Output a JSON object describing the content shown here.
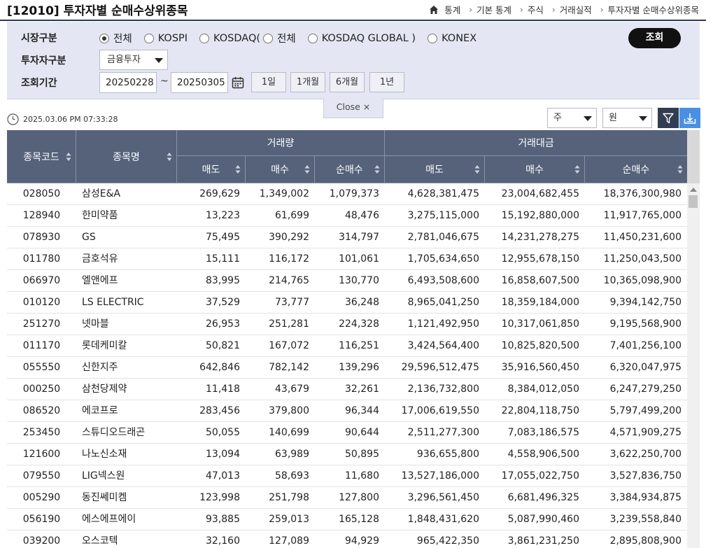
{
  "header": {
    "title": "[12010] 투자자별 순매수상위종목",
    "breadcrumb": [
      "통계",
      "기본 통계",
      "주식",
      "거래실적",
      "투자자별 순매수상위종목"
    ]
  },
  "search": {
    "market_label": "시장구분",
    "market_options": [
      {
        "label": "전체",
        "checked": true
      },
      {
        "label": "KOSPI",
        "checked": false
      },
      {
        "label": "KOSDAQ(",
        "checked": false
      },
      {
        "label": "전체",
        "checked": false
      },
      {
        "label": "KOSDAQ GLOBAL )",
        "checked": false
      },
      {
        "label": "KONEX",
        "checked": false
      }
    ],
    "investor_label": "투자자구분",
    "investor_value": "금융투자",
    "period_label": "조회기간",
    "date_from": "20250228",
    "date_sep": "~",
    "date_to": "20250305",
    "period_buttons": [
      "1일",
      "1개월",
      "6개월",
      "1년"
    ],
    "search_button": "조회",
    "close_label": "Close ×"
  },
  "toolbar": {
    "timestamp": "2025.03.06 PM 07:33:28",
    "unit_share": "주",
    "unit_currency": "원",
    "filter_icon": "filter-icon",
    "download_icon": "download-icon"
  },
  "table": {
    "headers": {
      "code": "종목코드",
      "name": "종목명",
      "volume_group": "거래량",
      "amount_group": "거래대금",
      "sell": "매도",
      "buy": "매수",
      "net": "순매수"
    },
    "rows": [
      {
        "code": "028050",
        "name": "삼성E&A",
        "vol_sell": "269,629",
        "vol_buy": "1,349,002",
        "vol_net": "1,079,373",
        "amt_sell": "4,628,381,475",
        "amt_buy": "23,004,682,455",
        "amt_net": "18,376,300,980"
      },
      {
        "code": "128940",
        "name": "한미약품",
        "vol_sell": "13,223",
        "vol_buy": "61,699",
        "vol_net": "48,476",
        "amt_sell": "3,275,115,000",
        "amt_buy": "15,192,880,000",
        "amt_net": "11,917,765,000"
      },
      {
        "code": "078930",
        "name": "GS",
        "vol_sell": "75,495",
        "vol_buy": "390,292",
        "vol_net": "314,797",
        "amt_sell": "2,781,046,675",
        "amt_buy": "14,231,278,275",
        "amt_net": "11,450,231,600"
      },
      {
        "code": "011780",
        "name": "금호석유",
        "vol_sell": "15,111",
        "vol_buy": "116,172",
        "vol_net": "101,061",
        "amt_sell": "1,705,634,650",
        "amt_buy": "12,955,678,150",
        "amt_net": "11,250,043,500"
      },
      {
        "code": "066970",
        "name": "엘앤에프",
        "vol_sell": "83,995",
        "vol_buy": "214,765",
        "vol_net": "130,770",
        "amt_sell": "6,493,508,600",
        "amt_buy": "16,858,607,500",
        "amt_net": "10,365,098,900"
      },
      {
        "code": "010120",
        "name": "LS ELECTRIC",
        "vol_sell": "37,529",
        "vol_buy": "73,777",
        "vol_net": "36,248",
        "amt_sell": "8,965,041,250",
        "amt_buy": "18,359,184,000",
        "amt_net": "9,394,142,750"
      },
      {
        "code": "251270",
        "name": "넷마블",
        "vol_sell": "26,953",
        "vol_buy": "251,281",
        "vol_net": "224,328",
        "amt_sell": "1,121,492,950",
        "amt_buy": "10,317,061,850",
        "amt_net": "9,195,568,900"
      },
      {
        "code": "011170",
        "name": "롯데케미칼",
        "vol_sell": "50,821",
        "vol_buy": "167,072",
        "vol_net": "116,251",
        "amt_sell": "3,424,564,400",
        "amt_buy": "10,825,820,500",
        "amt_net": "7,401,256,100"
      },
      {
        "code": "055550",
        "name": "신한지주",
        "vol_sell": "642,846",
        "vol_buy": "782,142",
        "vol_net": "139,296",
        "amt_sell": "29,596,512,475",
        "amt_buy": "35,916,560,450",
        "amt_net": "6,320,047,975"
      },
      {
        "code": "000250",
        "name": "삼천당제약",
        "vol_sell": "11,418",
        "vol_buy": "43,679",
        "vol_net": "32,261",
        "amt_sell": "2,136,732,800",
        "amt_buy": "8,384,012,050",
        "amt_net": "6,247,279,250"
      },
      {
        "code": "086520",
        "name": "에코프로",
        "vol_sell": "283,456",
        "vol_buy": "379,800",
        "vol_net": "96,344",
        "amt_sell": "17,006,619,550",
        "amt_buy": "22,804,118,750",
        "amt_net": "5,797,499,200"
      },
      {
        "code": "253450",
        "name": "스튜디오드래곤",
        "vol_sell": "50,055",
        "vol_buy": "140,699",
        "vol_net": "90,644",
        "amt_sell": "2,511,277,300",
        "amt_buy": "7,083,186,575",
        "amt_net": "4,571,909,275"
      },
      {
        "code": "121600",
        "name": "나노신소재",
        "vol_sell": "13,094",
        "vol_buy": "63,989",
        "vol_net": "50,895",
        "amt_sell": "936,655,800",
        "amt_buy": "4,558,906,500",
        "amt_net": "3,622,250,700"
      },
      {
        "code": "079550",
        "name": "LIG넥스원",
        "vol_sell": "47,013",
        "vol_buy": "58,693",
        "vol_net": "11,680",
        "amt_sell": "13,527,186,000",
        "amt_buy": "17,055,022,750",
        "amt_net": "3,527,836,750"
      },
      {
        "code": "005290",
        "name": "동진쎄미켐",
        "vol_sell": "123,998",
        "vol_buy": "251,798",
        "vol_net": "127,800",
        "amt_sell": "3,296,561,450",
        "amt_buy": "6,681,496,325",
        "amt_net": "3,384,934,875"
      },
      {
        "code": "056190",
        "name": "에스에프에이",
        "vol_sell": "93,885",
        "vol_buy": "259,013",
        "vol_net": "165,128",
        "amt_sell": "1,848,431,620",
        "amt_buy": "5,087,990,460",
        "amt_net": "3,239,558,840"
      },
      {
        "code": "039200",
        "name": "오스코텍",
        "vol_sell": "32,160",
        "vol_buy": "127,089",
        "vol_net": "94,929",
        "amt_sell": "965,422,350",
        "amt_buy": "3,861,231,250",
        "amt_net": "2,895,808,900"
      }
    ]
  }
}
